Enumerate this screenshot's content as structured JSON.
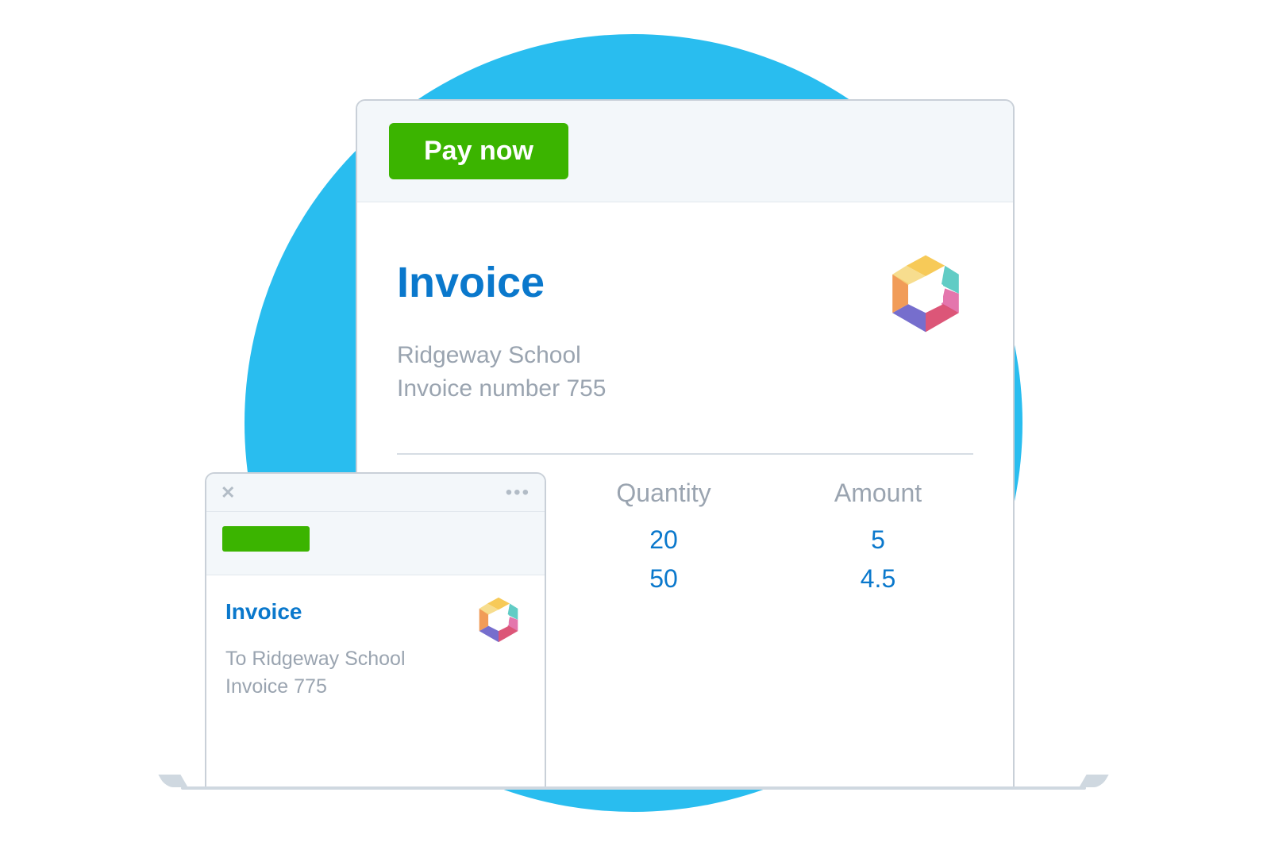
{
  "colors": {
    "bg_circle": "#29bdef",
    "accent": "#0a78cc",
    "action": "#3bb400",
    "muted": "#9aa4b0",
    "border": "#c9d0d8"
  },
  "main": {
    "pay_label": "Pay now",
    "title": "Invoice",
    "recipient": "Ridgeway School",
    "invoice_number_line": "Invoice number 755",
    "columns": [
      "Quantity",
      "Amount"
    ],
    "rows": [
      {
        "quantity": "20",
        "amount": "5"
      },
      {
        "quantity": "50",
        "amount": "4.5"
      }
    ],
    "logo_name": "hexagon-logo"
  },
  "mobile": {
    "title": "Invoice",
    "recipient_line": "To Ridgeway School",
    "invoice_line": "Invoice 775",
    "close_glyph": "✕",
    "more_glyph": "•••",
    "logo_name": "hexagon-logo"
  }
}
